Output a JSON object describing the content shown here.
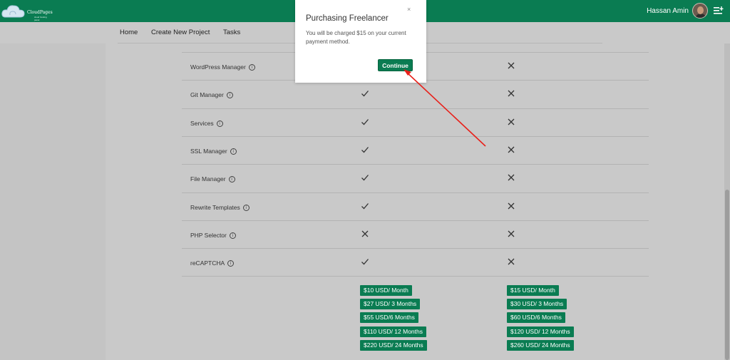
{
  "header": {
    "logo_text": "CloudPages",
    "logo_sub": "cloud hosting panel",
    "user_name": "Hassan Amin"
  },
  "nav": {
    "items": [
      "Home",
      "Create New Project",
      "Tasks"
    ]
  },
  "features": [
    {
      "name": "WordPress Manager",
      "plan1": "check",
      "plan2": "cross"
    },
    {
      "name": "Git Manager",
      "plan1": "check",
      "plan2": "cross"
    },
    {
      "name": "Services",
      "plan1": "check",
      "plan2": "cross"
    },
    {
      "name": "SSL Manager",
      "plan1": "check",
      "plan2": "cross"
    },
    {
      "name": "File Manager",
      "plan1": "check",
      "plan2": "cross"
    },
    {
      "name": "Rewrite Templates",
      "plan1": "check",
      "plan2": "cross"
    },
    {
      "name": "PHP Selector",
      "plan1": "cross",
      "plan2": "cross"
    },
    {
      "name": "reCAPTCHA",
      "plan1": "check",
      "plan2": "cross"
    }
  ],
  "info_icon": "i",
  "pricing": {
    "plan1": [
      "$10 USD/ Month",
      "$27 USD/ 3 Months",
      "$55 USD/6 Months",
      "$110 USD/ 12 Months",
      "$220 USD/ 24 Months"
    ],
    "plan2": [
      "$15 USD/ Month",
      "$30 USD/ 3 Months",
      "$60 USD/6 Months",
      "$120 USD/ 12 Months",
      "$260 USD/ 24 Months"
    ]
  },
  "modal": {
    "title": "Purchasing Freelancer",
    "close": "×",
    "body": "You will be charged $15 on your current payment method.",
    "button": "Continue"
  },
  "colors": {
    "brand": "#0a7c52",
    "arrow": "#e8201a"
  },
  "icons": {
    "check": "check-icon",
    "cross": "cross-icon",
    "info": "info-icon",
    "menu": "menu-icon",
    "cloud": "cloud-icon"
  }
}
